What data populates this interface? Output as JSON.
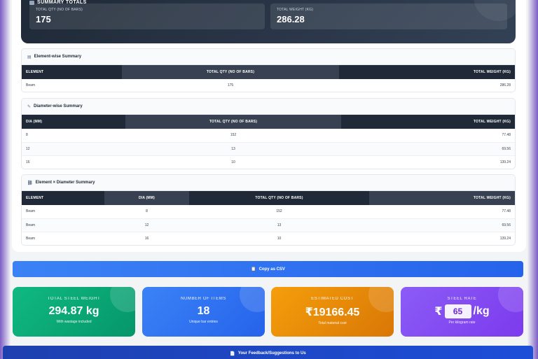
{
  "summary_totals": {
    "title": "SUMMARY TOTALS",
    "qty_label": "TOTAL QTY (NO OF BARS)",
    "qty_value": "175",
    "weight_label": "TOTAL WEIGHT (KG)",
    "weight_value": "286.28"
  },
  "element_summary": {
    "title": "Element-wise Summary",
    "headers": [
      "ELEMENT",
      "TOTAL QTY (NO OF BARS)",
      "TOTAL WEIGHT (KG)"
    ],
    "rows": [
      [
        "Beam",
        "175",
        "286.28"
      ]
    ]
  },
  "diameter_summary": {
    "title": "Diameter-wise Summary",
    "headers": [
      "DIA (MM)",
      "TOTAL QTY (NO OF BARS)",
      "TOTAL WEIGHT (KG)"
    ],
    "rows": [
      [
        "8",
        "152",
        "77.48"
      ],
      [
        "12",
        "13",
        "69.56"
      ],
      [
        "16",
        "10",
        "139.24"
      ]
    ]
  },
  "element_diameter_summary": {
    "title": "Element × Diameter Summary",
    "headers": [
      "ELEMENT",
      "DIA (MM)",
      "TOTAL QTY (NO OF BARS)",
      "TOTAL WEIGHT (KG)"
    ],
    "rows": [
      [
        "Beam",
        "8",
        "152",
        "77.48"
      ],
      [
        "Beam",
        "12",
        "13",
        "69.56"
      ],
      [
        "Beam",
        "16",
        "10",
        "139.24"
      ]
    ]
  },
  "csv_button": {
    "label": "Copy as CSV"
  },
  "stats": {
    "steel_weight": {
      "label": "TOTAL STEEL WEIGHT",
      "value": "294.87 kg",
      "sub": "With wastage included"
    },
    "items": {
      "label": "NUMBER OF ITEMS",
      "value": "18",
      "sub": "Unique bar entries"
    },
    "cost": {
      "label": "ESTIMATED COST",
      "value": "₹19166.45",
      "sub": "Total material cost"
    },
    "rate": {
      "label": "STEEL RATE",
      "currency": "₹",
      "value": "65",
      "unit": "/kg",
      "sub": "Per kilogram rate"
    }
  },
  "feedback_button": {
    "label": "Your Feedback/Suggestions to Us"
  },
  "colors": {
    "dark_header": "#1f2937",
    "green": "#10b981",
    "blue": "#3b82f6",
    "orange": "#f59e0b",
    "purple": "#8b5cf6"
  }
}
